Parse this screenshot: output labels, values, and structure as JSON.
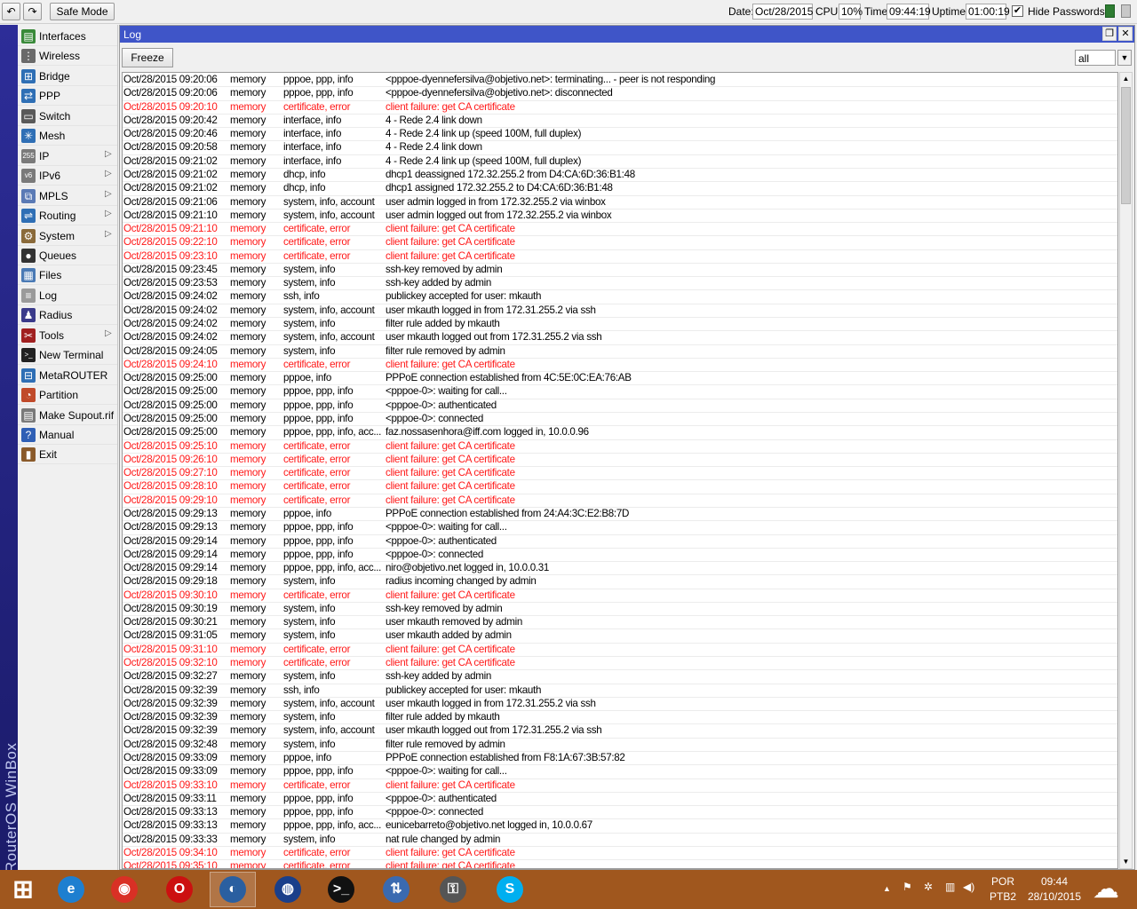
{
  "toolbar": {
    "back_icon": "undo-icon",
    "forward_icon": "redo-icon",
    "back_glyph": "↶",
    "forward_glyph": "↷",
    "safe_mode": "Safe Mode",
    "date_label": "Date:",
    "date_value": "Oct/28/2015",
    "cpu_label": "CPU:",
    "cpu_value": "10%",
    "time_label": "Time:",
    "time_value": "09:44:19",
    "uptime_label": "Uptime:",
    "uptime_value": "01:00:19",
    "hide_passwords_checked": true,
    "check_mark": "✔",
    "hide_passwords_label": "Hide Passwords"
  },
  "brand": "RouterOS WinBox",
  "sidebar": {
    "items": [
      {
        "label": "Interfaces",
        "icon": "interfaces-icon",
        "glyph": "▤",
        "color": "#3a8a3a",
        "submenu": false
      },
      {
        "label": "Wireless",
        "icon": "wireless-icon",
        "glyph": "⋮",
        "color": "#6a6a6a",
        "submenu": false
      },
      {
        "label": "Bridge",
        "icon": "bridge-icon",
        "glyph": "⊞",
        "color": "#2f6fb5",
        "submenu": false
      },
      {
        "label": "PPP",
        "icon": "ppp-icon",
        "glyph": "⇄",
        "color": "#2f6fb5",
        "submenu": false
      },
      {
        "label": "Switch",
        "icon": "switch-icon",
        "glyph": "▭",
        "color": "#5a5a5a",
        "submenu": false
      },
      {
        "label": "Mesh",
        "icon": "mesh-icon",
        "glyph": "✳",
        "color": "#2f6fb5",
        "submenu": false
      },
      {
        "label": "IP",
        "icon": "ip-icon",
        "glyph": "255",
        "color": "#7a7a7a",
        "submenu": true
      },
      {
        "label": "IPv6",
        "icon": "ipv6-icon",
        "glyph": "v6",
        "color": "#7a7a7a",
        "submenu": true
      },
      {
        "label": "MPLS",
        "icon": "mpls-icon",
        "glyph": "⧉",
        "color": "#5a7ab5",
        "submenu": true
      },
      {
        "label": "Routing",
        "icon": "routing-icon",
        "glyph": "⇌",
        "color": "#2f6fb5",
        "submenu": true
      },
      {
        "label": "System",
        "icon": "system-icon",
        "glyph": "⚙",
        "color": "#8a6a3a",
        "submenu": true
      },
      {
        "label": "Queues",
        "icon": "queues-icon",
        "glyph": "●",
        "color": "#333333",
        "submenu": false
      },
      {
        "label": "Files",
        "icon": "files-icon",
        "glyph": "▦",
        "color": "#4a7ab5",
        "submenu": false
      },
      {
        "label": "Log",
        "icon": "log-icon",
        "glyph": "≡",
        "color": "#9a9a9a",
        "submenu": false
      },
      {
        "label": "Radius",
        "icon": "radius-icon",
        "glyph": "♟",
        "color": "#3a3a8a",
        "submenu": false
      },
      {
        "label": "Tools",
        "icon": "tools-icon",
        "glyph": "✂",
        "color": "#a02020",
        "submenu": true
      },
      {
        "label": "New Terminal",
        "icon": "terminal-icon",
        "glyph": ">_",
        "color": "#222222",
        "submenu": false
      },
      {
        "label": "MetaROUTER",
        "icon": "metarouter-icon",
        "glyph": "⊟",
        "color": "#2f6fb5",
        "submenu": false
      },
      {
        "label": "Partition",
        "icon": "partition-icon",
        "glyph": "◔",
        "color": "#c04a2a",
        "submenu": false
      },
      {
        "label": "Make Supout.rif",
        "icon": "supout-icon",
        "glyph": "▤",
        "color": "#7a7a7a",
        "submenu": false
      },
      {
        "label": "Manual",
        "icon": "manual-icon",
        "glyph": "?",
        "color": "#2f5fb5",
        "submenu": false
      },
      {
        "label": "Exit",
        "icon": "exit-icon",
        "glyph": "▮",
        "color": "#8a5a2a",
        "submenu": false
      }
    ]
  },
  "log_window": {
    "title": "Log",
    "restore_glyph": "❐",
    "close_glyph": "✕",
    "freeze_label": "Freeze",
    "filter_value": "all",
    "dropdown_glyph": "▼",
    "scroll_up_glyph": "▲",
    "scroll_down_glyph": "▼",
    "error_color": "#ff1a1a",
    "rows": [
      [
        "Oct/28/2015 09:20:06",
        "memory",
        "pppoe, ppp, info",
        "<pppoe-dyennefersilva@objetivo.net>: terminating... - peer is not responding"
      ],
      [
        "Oct/28/2015 09:20:06",
        "memory",
        "pppoe, ppp, info",
        "<pppoe-dyennefersilva@objetivo.net>: disconnected"
      ],
      [
        "Oct/28/2015 09:20:10",
        "memory",
        "certificate, error",
        "client failure: get CA certificate"
      ],
      [
        "Oct/28/2015 09:20:42",
        "memory",
        "interface, info",
        "4 - Rede 2.4 link down"
      ],
      [
        "Oct/28/2015 09:20:46",
        "memory",
        "interface, info",
        "4 - Rede 2.4 link up (speed 100M, full duplex)"
      ],
      [
        "Oct/28/2015 09:20:58",
        "memory",
        "interface, info",
        "4 - Rede 2.4 link down"
      ],
      [
        "Oct/28/2015 09:21:02",
        "memory",
        "interface, info",
        "4 - Rede 2.4 link up (speed 100M, full duplex)"
      ],
      [
        "Oct/28/2015 09:21:02",
        "memory",
        "dhcp, info",
        "dhcp1 deassigned 172.32.255.2 from D4:CA:6D:36:B1:48"
      ],
      [
        "Oct/28/2015 09:21:02",
        "memory",
        "dhcp, info",
        "dhcp1 assigned 172.32.255.2 to D4:CA:6D:36:B1:48"
      ],
      [
        "Oct/28/2015 09:21:06",
        "memory",
        "system, info, account",
        "user admin logged in from 172.32.255.2 via winbox"
      ],
      [
        "Oct/28/2015 09:21:10",
        "memory",
        "system, info, account",
        "user admin logged out from 172.32.255.2 via winbox"
      ],
      [
        "Oct/28/2015 09:21:10",
        "memory",
        "certificate, error",
        "client failure: get CA certificate"
      ],
      [
        "Oct/28/2015 09:22:10",
        "memory",
        "certificate, error",
        "client failure: get CA certificate"
      ],
      [
        "Oct/28/2015 09:23:10",
        "memory",
        "certificate, error",
        "client failure: get CA certificate"
      ],
      [
        "Oct/28/2015 09:23:45",
        "memory",
        "system, info",
        "ssh-key removed by admin"
      ],
      [
        "Oct/28/2015 09:23:53",
        "memory",
        "system, info",
        "ssh-key added by admin"
      ],
      [
        "Oct/28/2015 09:24:02",
        "memory",
        "ssh, info",
        "publickey accepted for user: mkauth"
      ],
      [
        "Oct/28/2015 09:24:02",
        "memory",
        "system, info, account",
        "user mkauth logged in from 172.31.255.2 via ssh"
      ],
      [
        "Oct/28/2015 09:24:02",
        "memory",
        "system, info",
        "filter rule added by mkauth"
      ],
      [
        "Oct/28/2015 09:24:02",
        "memory",
        "system, info, account",
        "user mkauth logged out from 172.31.255.2 via ssh"
      ],
      [
        "Oct/28/2015 09:24:05",
        "memory",
        "system, info",
        "filter rule removed by admin"
      ],
      [
        "Oct/28/2015 09:24:10",
        "memory",
        "certificate, error",
        "client failure: get CA certificate"
      ],
      [
        "Oct/28/2015 09:25:00",
        "memory",
        "pppoe, info",
        "PPPoE connection established from 4C:5E:0C:EA:76:AB"
      ],
      [
        "Oct/28/2015 09:25:00",
        "memory",
        "pppoe, ppp, info",
        "<pppoe-0>: waiting for call..."
      ],
      [
        "Oct/28/2015 09:25:00",
        "memory",
        "pppoe, ppp, info",
        "<pppoe-0>: authenticated"
      ],
      [
        "Oct/28/2015 09:25:00",
        "memory",
        "pppoe, ppp, info",
        "<pppoe-0>: connected"
      ],
      [
        "Oct/28/2015 09:25:00",
        "memory",
        "pppoe, ppp, info, acc...",
        "faz.nossasenhora@iff.com logged in, 10.0.0.96"
      ],
      [
        "Oct/28/2015 09:25:10",
        "memory",
        "certificate, error",
        "client failure: get CA certificate"
      ],
      [
        "Oct/28/2015 09:26:10",
        "memory",
        "certificate, error",
        "client failure: get CA certificate"
      ],
      [
        "Oct/28/2015 09:27:10",
        "memory",
        "certificate, error",
        "client failure: get CA certificate"
      ],
      [
        "Oct/28/2015 09:28:10",
        "memory",
        "certificate, error",
        "client failure: get CA certificate"
      ],
      [
        "Oct/28/2015 09:29:10",
        "memory",
        "certificate, error",
        "client failure: get CA certificate"
      ],
      [
        "Oct/28/2015 09:29:13",
        "memory",
        "pppoe, info",
        "PPPoE connection established from 24:A4:3C:E2:B8:7D"
      ],
      [
        "Oct/28/2015 09:29:13",
        "memory",
        "pppoe, ppp, info",
        "<pppoe-0>: waiting for call..."
      ],
      [
        "Oct/28/2015 09:29:14",
        "memory",
        "pppoe, ppp, info",
        "<pppoe-0>: authenticated"
      ],
      [
        "Oct/28/2015 09:29:14",
        "memory",
        "pppoe, ppp, info",
        "<pppoe-0>: connected"
      ],
      [
        "Oct/28/2015 09:29:14",
        "memory",
        "pppoe, ppp, info, acc...",
        "niro@objetivo.net logged in, 10.0.0.31"
      ],
      [
        "Oct/28/2015 09:29:18",
        "memory",
        "system, info",
        "radius incoming changed by admin"
      ],
      [
        "Oct/28/2015 09:30:10",
        "memory",
        "certificate, error",
        "client failure: get CA certificate"
      ],
      [
        "Oct/28/2015 09:30:19",
        "memory",
        "system, info",
        "ssh-key removed by admin"
      ],
      [
        "Oct/28/2015 09:30:21",
        "memory",
        "system, info",
        "user mkauth removed by admin"
      ],
      [
        "Oct/28/2015 09:31:05",
        "memory",
        "system, info",
        "user mkauth added by admin"
      ],
      [
        "Oct/28/2015 09:31:10",
        "memory",
        "certificate, error",
        "client failure: get CA certificate"
      ],
      [
        "Oct/28/2015 09:32:10",
        "memory",
        "certificate, error",
        "client failure: get CA certificate"
      ],
      [
        "Oct/28/2015 09:32:27",
        "memory",
        "system, info",
        "ssh-key added by admin"
      ],
      [
        "Oct/28/2015 09:32:39",
        "memory",
        "ssh, info",
        "publickey accepted for user: mkauth"
      ],
      [
        "Oct/28/2015 09:32:39",
        "memory",
        "system, info, account",
        "user mkauth logged in from 172.31.255.2 via ssh"
      ],
      [
        "Oct/28/2015 09:32:39",
        "memory",
        "system, info",
        "filter rule added by mkauth"
      ],
      [
        "Oct/28/2015 09:32:39",
        "memory",
        "system, info, account",
        "user mkauth logged out from 172.31.255.2 via ssh"
      ],
      [
        "Oct/28/2015 09:32:48",
        "memory",
        "system, info",
        "filter rule removed by admin"
      ],
      [
        "Oct/28/2015 09:33:09",
        "memory",
        "pppoe, info",
        "PPPoE connection established from F8:1A:67:3B:57:82"
      ],
      [
        "Oct/28/2015 09:33:09",
        "memory",
        "pppoe, ppp, info",
        "<pppoe-0>: waiting for call..."
      ],
      [
        "Oct/28/2015 09:33:10",
        "memory",
        "certificate, error",
        "client failure: get CA certificate"
      ],
      [
        "Oct/28/2015 09:33:11",
        "memory",
        "pppoe, ppp, info",
        "<pppoe-0>: authenticated"
      ],
      [
        "Oct/28/2015 09:33:13",
        "memory",
        "pppoe, ppp, info",
        "<pppoe-0>: connected"
      ],
      [
        "Oct/28/2015 09:33:13",
        "memory",
        "pppoe, ppp, info, acc...",
        "eunicebarreto@objetivo.net logged in, 10.0.0.67"
      ],
      [
        "Oct/28/2015 09:33:33",
        "memory",
        "system, info",
        "nat rule changed by admin"
      ],
      [
        "Oct/28/2015 09:34:10",
        "memory",
        "certificate, error",
        "client failure: get CA certificate"
      ],
      [
        "Oct/28/2015 09:35:10",
        "memory",
        "certificate, error",
        "client failure: get CA certificate"
      ]
    ]
  },
  "taskbar": {
    "apps": [
      {
        "name": "start-button",
        "glyph": "⊞",
        "color": "#a0571e",
        "active": false
      },
      {
        "name": "internet-explorer-icon",
        "glyph": "e",
        "color": "#1e7fd0",
        "active": false
      },
      {
        "name": "chrome-icon",
        "glyph": "◉",
        "color": "#d93025",
        "active": false
      },
      {
        "name": "opera-icon",
        "glyph": "O",
        "color": "#cc1010",
        "active": false
      },
      {
        "name": "winbox-icon",
        "glyph": "◐",
        "color": "#2a5fa0",
        "active": true
      },
      {
        "name": "google-earth-icon",
        "glyph": "◍",
        "color": "#1a3f8a",
        "active": false
      },
      {
        "name": "cmd-icon",
        "glyph": ">_",
        "color": "#111111",
        "active": false
      },
      {
        "name": "network-tool-icon",
        "glyph": "⇅",
        "color": "#3a6ab0",
        "active": false
      },
      {
        "name": "vpn-client-icon",
        "glyph": "⚿",
        "color": "#555555",
        "active": false
      },
      {
        "name": "skype-icon",
        "glyph": "S",
        "color": "#00aff0",
        "active": false
      }
    ],
    "tray_up_glyph": "▲",
    "flag_glyph": "⚑",
    "gear_glyph": "✲",
    "network_glyph": "▥",
    "volume_glyph": "◀)",
    "lang": "POR",
    "lang2": "PTB2",
    "clock_time": "09:44",
    "clock_date": "28/10/2015",
    "weather_glyph": "☁"
  }
}
